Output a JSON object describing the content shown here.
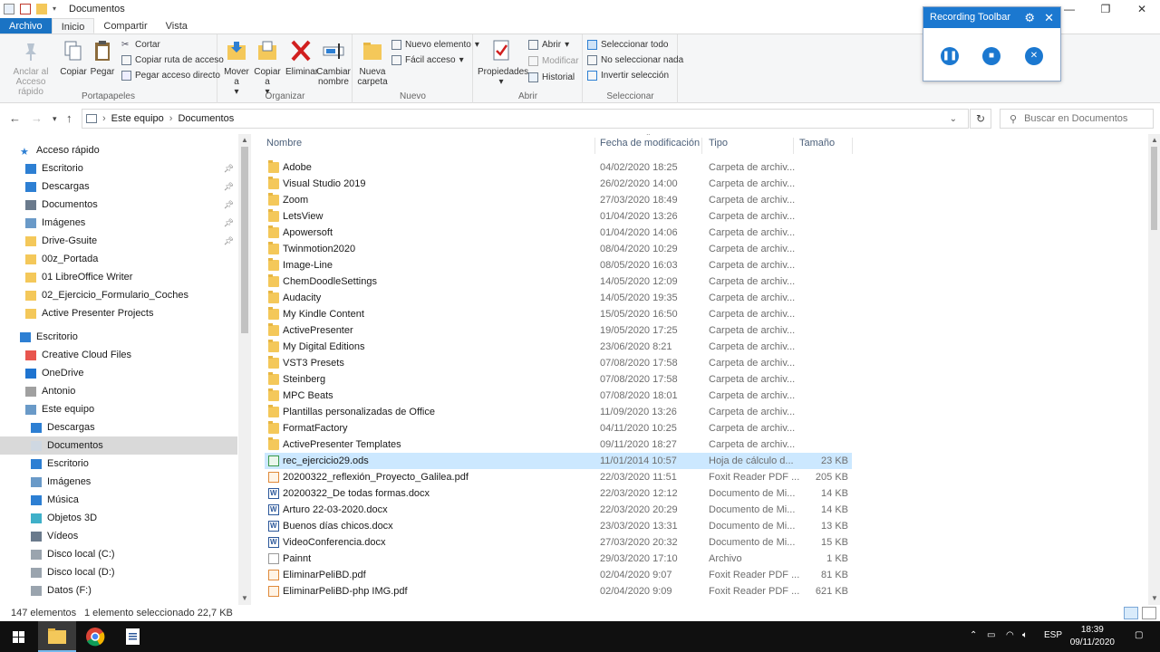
{
  "window": {
    "title": "Documentos"
  },
  "tabs": [
    "Archivo",
    "Inicio",
    "Compartir",
    "Vista"
  ],
  "ribbon": {
    "portapapeles": {
      "label": "Portapapeles",
      "anclar": "Anclar al Acceso rápido",
      "copiar": "Copiar",
      "pegar": "Pegar",
      "cortar": "Cortar",
      "copiar_ruta": "Copiar ruta de acceso",
      "pegar_acceso": "Pegar acceso directo"
    },
    "organizar": {
      "label": "Organizar",
      "mover": "Mover a",
      "copiar": "Copiar a",
      "eliminar": "Eliminar",
      "cambiar": "Cambiar nombre"
    },
    "nuevo": {
      "label": "Nuevo",
      "nueva_carpeta": "Nueva carpeta",
      "nuevo_elemento": "Nuevo elemento",
      "facil_acceso": "Fácil acceso"
    },
    "abrir": {
      "label": "Abrir",
      "propiedades": "Propiedades",
      "abrir": "Abrir",
      "modificar": "Modificar",
      "historial": "Historial"
    },
    "seleccionar": {
      "label": "Seleccionar",
      "todo": "Seleccionar todo",
      "nada": "No seleccionar nada",
      "invertir": "Invertir selección"
    }
  },
  "recording_toolbar": {
    "title": "Recording Toolbar",
    "accent": "#1b78d0"
  },
  "address": {
    "segments": [
      "Este equipo",
      "Documentos"
    ],
    "search_placeholder": "Buscar en Documentos"
  },
  "nav": {
    "quick_access": "Acceso rápido",
    "items": [
      {
        "label": "Escritorio",
        "pinned": true
      },
      {
        "label": "Descargas",
        "pinned": true
      },
      {
        "label": "Documentos",
        "pinned": true
      },
      {
        "label": "Imágenes",
        "pinned": true
      },
      {
        "label": "Drive-Gsuite",
        "pinned": true
      },
      {
        "label": "00z_Portada",
        "pinned": false
      },
      {
        "label": "01 LibreOffice Writer",
        "pinned": false
      },
      {
        "label": "02_Ejercicio_Formulario_Coches",
        "pinned": false
      },
      {
        "label": "Active Presenter Projects",
        "pinned": false
      }
    ],
    "tree": [
      {
        "label": "Escritorio"
      },
      {
        "label": "Creative Cloud Files"
      },
      {
        "label": "OneDrive"
      },
      {
        "label": "Antonio"
      },
      {
        "label": "Este equipo"
      },
      {
        "label": "Descargas"
      },
      {
        "label": "Documentos"
      },
      {
        "label": "Escritorio"
      },
      {
        "label": "Imágenes"
      },
      {
        "label": "Música"
      },
      {
        "label": "Objetos 3D"
      },
      {
        "label": "Vídeos"
      },
      {
        "label": "Disco local (C:)"
      },
      {
        "label": "Disco local (D:)"
      },
      {
        "label": "Datos (F:)"
      }
    ]
  },
  "columns": {
    "name": "Nombre",
    "date": "Fecha de modificación",
    "type": "Tipo",
    "size": "Tamaño"
  },
  "files": [
    {
      "name": "Adobe",
      "date": "04/02/2020 18:25",
      "type": "Carpeta de archiv...",
      "size": "",
      "icon": "folder"
    },
    {
      "name": "Visual Studio 2019",
      "date": "26/02/2020 14:00",
      "type": "Carpeta de archiv...",
      "size": "",
      "icon": "folder"
    },
    {
      "name": "Zoom",
      "date": "27/03/2020 18:49",
      "type": "Carpeta de archiv...",
      "size": "",
      "icon": "folder"
    },
    {
      "name": "LetsView",
      "date": "01/04/2020 13:26",
      "type": "Carpeta de archiv...",
      "size": "",
      "icon": "folder"
    },
    {
      "name": "Apowersoft",
      "date": "01/04/2020 14:06",
      "type": "Carpeta de archiv...",
      "size": "",
      "icon": "folder"
    },
    {
      "name": "Twinmotion2020",
      "date": "08/04/2020 10:29",
      "type": "Carpeta de archiv...",
      "size": "",
      "icon": "folder"
    },
    {
      "name": "Image-Line",
      "date": "08/05/2020 16:03",
      "type": "Carpeta de archiv...",
      "size": "",
      "icon": "folder"
    },
    {
      "name": "ChemDoodleSettings",
      "date": "14/05/2020 12:09",
      "type": "Carpeta de archiv...",
      "size": "",
      "icon": "folder"
    },
    {
      "name": "Audacity",
      "date": "14/05/2020 19:35",
      "type": "Carpeta de archiv...",
      "size": "",
      "icon": "folder"
    },
    {
      "name": "My Kindle Content",
      "date": "15/05/2020 16:50",
      "type": "Carpeta de archiv...",
      "size": "",
      "icon": "folder"
    },
    {
      "name": "ActivePresenter",
      "date": "19/05/2020 17:25",
      "type": "Carpeta de archiv...",
      "size": "",
      "icon": "folder"
    },
    {
      "name": "My Digital Editions",
      "date": "23/06/2020 8:21",
      "type": "Carpeta de archiv...",
      "size": "",
      "icon": "folder"
    },
    {
      "name": "VST3 Presets",
      "date": "07/08/2020 17:58",
      "type": "Carpeta de archiv...",
      "size": "",
      "icon": "folder"
    },
    {
      "name": "Steinberg",
      "date": "07/08/2020 17:58",
      "type": "Carpeta de archiv...",
      "size": "",
      "icon": "folder"
    },
    {
      "name": "MPC Beats",
      "date": "07/08/2020 18:01",
      "type": "Carpeta de archiv...",
      "size": "",
      "icon": "folder"
    },
    {
      "name": "Plantillas personalizadas de Office",
      "date": "11/09/2020 13:26",
      "type": "Carpeta de archiv...",
      "size": "",
      "icon": "folder"
    },
    {
      "name": "FormatFactory",
      "date": "04/11/2020 10:25",
      "type": "Carpeta de archiv...",
      "size": "",
      "icon": "folder"
    },
    {
      "name": "ActivePresenter Templates",
      "date": "09/11/2020 18:27",
      "type": "Carpeta de archiv...",
      "size": "",
      "icon": "folder"
    },
    {
      "name": "rec_ejercicio29.ods",
      "date": "11/01/2014 10:57",
      "type": "Hoja de cálculo d...",
      "size": "23 KB",
      "icon": "ods",
      "selected": true
    },
    {
      "name": "20200322_reflexión_Proyecto_Galilea.pdf",
      "date": "22/03/2020 11:51",
      "type": "Foxit Reader PDF ...",
      "size": "205 KB",
      "icon": "pdf"
    },
    {
      "name": "20200322_De todas formas.docx",
      "date": "22/03/2020 12:12",
      "type": "Documento de Mi...",
      "size": "14 KB",
      "icon": "doc"
    },
    {
      "name": "Arturo 22-03-2020.docx",
      "date": "22/03/2020 20:29",
      "type": "Documento de Mi...",
      "size": "14 KB",
      "icon": "doc"
    },
    {
      "name": "Buenos días chicos.docx",
      "date": "23/03/2020 13:31",
      "type": "Documento de Mi...",
      "size": "13 KB",
      "icon": "doc"
    },
    {
      "name": "VideoConferencia.docx",
      "date": "27/03/2020 20:32",
      "type": "Documento de Mi...",
      "size": "15 KB",
      "icon": "doc"
    },
    {
      "name": "Painnt",
      "date": "29/03/2020 17:10",
      "type": "Archivo",
      "size": "1 KB",
      "icon": "plain"
    },
    {
      "name": "EliminarPeliBD.pdf",
      "date": "02/04/2020 9:07",
      "type": "Foxit Reader PDF ...",
      "size": "81 KB",
      "icon": "pdf"
    },
    {
      "name": "EliminarPeliBD-php IMG.pdf",
      "date": "02/04/2020 9:09",
      "type": "Foxit Reader PDF ...",
      "size": "621 KB",
      "icon": "pdf"
    }
  ],
  "status": {
    "count": "147 elementos",
    "selection": "1 elemento seleccionado  22,7 KB"
  },
  "taskbar": {
    "lang": "ESP",
    "time": "18:39",
    "date": "09/11/2020"
  }
}
